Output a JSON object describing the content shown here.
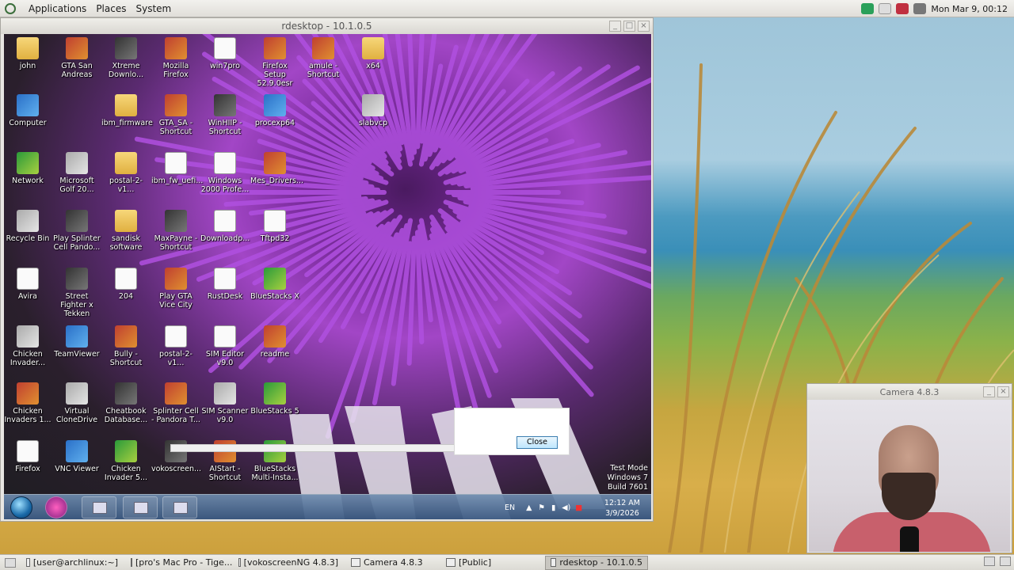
{
  "top_panel": {
    "menus": [
      "Applications",
      "Places",
      "System"
    ],
    "clock": "Mon Mar  9, 00:12"
  },
  "rdesktop": {
    "title": "rdesktop - 10.1.0.5",
    "icons": [
      "john",
      "GTA San Andreas",
      "Xtreme Downlo...",
      "Mozilla Firefox",
      "win7pro",
      "Firefox Setup 52.9.0esr",
      "amule - Shortcut",
      "x64",
      "Computer",
      "ibm_firmware",
      "GTA_SA - Shortcut",
      "WinHIIP - Shortcut",
      "procexp64",
      "slabvcp",
      "Network",
      "Microsoft Golf 20...",
      "postal-2-v1...",
      "ibm_fw_uefi...",
      "Windows 2000 Profe...",
      "Mes_Drivers...",
      "Recycle Bin",
      "Play Splinter Cell Pando...",
      "sandisk software",
      "MaxPayne - Shortcut",
      "Downloadp...",
      "Tftpd32",
      "Avira",
      "Street Fighter x Tekken",
      "204",
      "Play GTA Vice City",
      "RustDesk",
      "BlueStacks X",
      "Chicken Invader...",
      "TeamViewer",
      "Bully - Shortcut",
      "postal-2-v1...",
      "SIM Editor v9.0",
      "readme",
      "Chicken Invaders 1...",
      "Virtual CloneDrive",
      "Cheatbook Database...",
      "Splinter Cell - Pandora T...",
      "SIM Scanner v9.0",
      "BlueStacks 5",
      "Firefox",
      "VNC Viewer",
      "Chicken Invader 5...",
      "vokoscreen...",
      "AIStart - Shortcut",
      "BlueStacks Multi-Insta..."
    ],
    "dialog": {
      "close_label": "Close"
    },
    "testmode": {
      "line1": "Test Mode",
      "line2": "Windows 7",
      "line3": "Build 7601"
    },
    "taskbar": {
      "lang": "EN",
      "time": "12:12 AM",
      "date": "3/9/2026"
    }
  },
  "camera": {
    "title": "Camera 4.8.3"
  },
  "bottom_panel": {
    "tasks": [
      {
        "label": "[user@archlinux:~]"
      },
      {
        "label": "[pro's Mac Pro - Tige..."
      },
      {
        "label": "[vokoscreenNG 4.8.3]"
      },
      {
        "label": "Camera 4.8.3"
      },
      {
        "label": "[Public]"
      },
      {
        "label": "rdesktop - 10.1.0.5"
      }
    ]
  }
}
